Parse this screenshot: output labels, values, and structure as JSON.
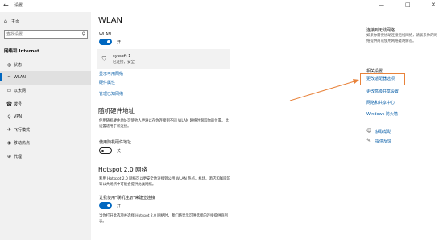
{
  "window": {
    "title": "设置",
    "back_glyph": "←",
    "minimize_glyph": "—",
    "maximize_glyph": "□",
    "close_glyph": "✕"
  },
  "sidebar": {
    "home_label": "主页",
    "home_icon": "home-icon",
    "search_placeholder": "查找设置",
    "section": "网络和 Internet",
    "items": [
      {
        "label": "状态",
        "icon": "globe-icon",
        "glyph": "◍"
      },
      {
        "label": "WLAN",
        "icon": "wifi-icon",
        "glyph": "⌔"
      },
      {
        "label": "以太网",
        "icon": "ethernet-icon",
        "glyph": "▭"
      },
      {
        "label": "拨号",
        "icon": "dialup-icon",
        "glyph": "☎"
      },
      {
        "label": "VPN",
        "icon": "vpn-icon",
        "glyph": "⚲"
      },
      {
        "label": "飞行模式",
        "icon": "airplane-icon",
        "glyph": "✈"
      },
      {
        "label": "移动热点",
        "icon": "hotspot-icon",
        "glyph": "◉"
      },
      {
        "label": "代理",
        "icon": "proxy-icon",
        "glyph": "⊕"
      }
    ],
    "active_index": 1
  },
  "main": {
    "title": "WLAN",
    "wlan_label": "WLAN",
    "wlan_state": "开",
    "network": {
      "name": "syssoft-1",
      "status": "已连接，安全"
    },
    "links": [
      "显示可用网络",
      "硬件属性",
      "管理已知网络"
    ],
    "random_hw": {
      "heading": "随机硬件地址",
      "desc": "使用随机硬件地址可使他人更难以在你连接到不同 WLAN 网络时跟踪你的位置。此设置适用于新连接。",
      "toggle_label": "使用随机硬件地址",
      "state": "关"
    },
    "hotspot": {
      "heading": "Hotspot 2.0 网络",
      "desc": "利用 Hotspot 2.0 网络可以更安全地连接到公用 WLAN 热点。机场、酒店和咖啡馆等公共场所中可能会提供此类网络。",
      "toggle_label": "让我使用\"联机注册\"来建立连接",
      "state": "开",
      "desc2": "当你打开此选项并选择 Hotspot 2.0 网络时，我们将显示可供选择的连接提供商列表。"
    }
  },
  "right": {
    "sync_heading": "连接到无线网络",
    "sync_desc": "如果你需要协助连接无线网络，请联系你的网络提供商或使用网络疑难解答。",
    "related_heading": "相关设置",
    "related_links": [
      "更改适配器选项",
      "更改高级共享设置",
      "网络和共享中心",
      "Windows 防火墙"
    ],
    "help_links": [
      {
        "label": "获取帮助",
        "icon": "help-icon",
        "glyph": "☺"
      },
      {
        "label": "提供反馈",
        "icon": "feedback-icon",
        "glyph": "✎"
      }
    ]
  },
  "colors": {
    "accent": "#0067c0",
    "link": "#0a5fa8",
    "annotation": "#e8823a"
  }
}
